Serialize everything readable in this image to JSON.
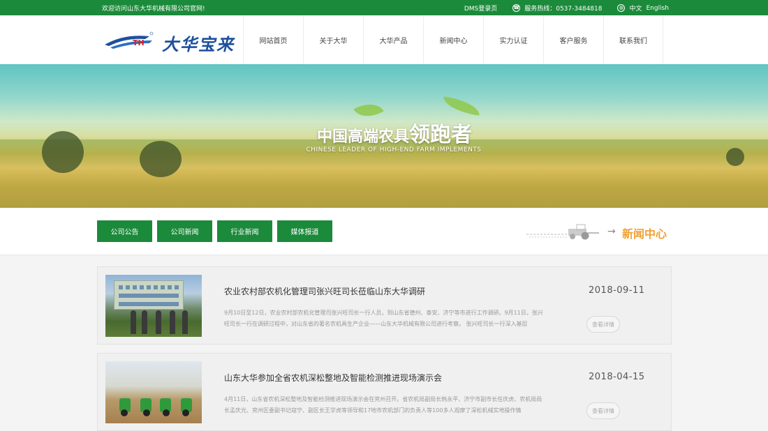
{
  "topbar": {
    "welcome": "欢迎访问山东大华机械有限公司官网!",
    "dms_login": "DMS登录页",
    "hotline": "服务热线：0537-3484818",
    "lang_cn": "中文",
    "lang_en": "English"
  },
  "header": {
    "logo_text": "大华宝来",
    "nav": [
      "网站首页",
      "关于大华",
      "大华产品",
      "新闻中心",
      "实力认证",
      "客户服务",
      "联系我们"
    ]
  },
  "banner": {
    "title_small": "中国高端农具",
    "title_big": "领跑者",
    "subtitle": "CHINESE LEADER OF HIGH-END FARM IMPLEMENTS"
  },
  "categories": [
    "公司公告",
    "公司新闻",
    "行业新闻",
    "媒体报道"
  ],
  "section_title": "新闻中心",
  "news": [
    {
      "title": "农业农村部农机化管理司张兴旺司长莅临山东大华调研",
      "desc": "9月10日至12日，农业农村部农机化管理司张兴旺司长一行人员，到山东省德州、泰安、济宁等市进行工作调研。9月11日，张兴旺司长一行在调研过程中，对山东省的著名农机具生产企业——山东大华机械有限公司进行考察。 张兴旺司长一行深入基层",
      "date": "2018-09-11",
      "more": "查看详情"
    },
    {
      "title": "山东大华参加全省农机深松整地及智能检测推进现场演示会",
      "desc": "4月11日，山东省农机深松整地及智能检测推进现场演示会在兖州召开。省农机局副局长韩永平、济宁市副市长任庆虎、农机局局长孟庆光、兖州区委副书记寇宁、副区长王学虎等领导和17地市农机部门的负责人等100多人观摩了深松机械实地操作情",
      "date": "2018-04-15",
      "more": "查看详情"
    }
  ],
  "colors": {
    "brand_green": "#1b8a3a",
    "accent_orange": "#f0a035",
    "logo_blue": "#1d4f9e"
  }
}
